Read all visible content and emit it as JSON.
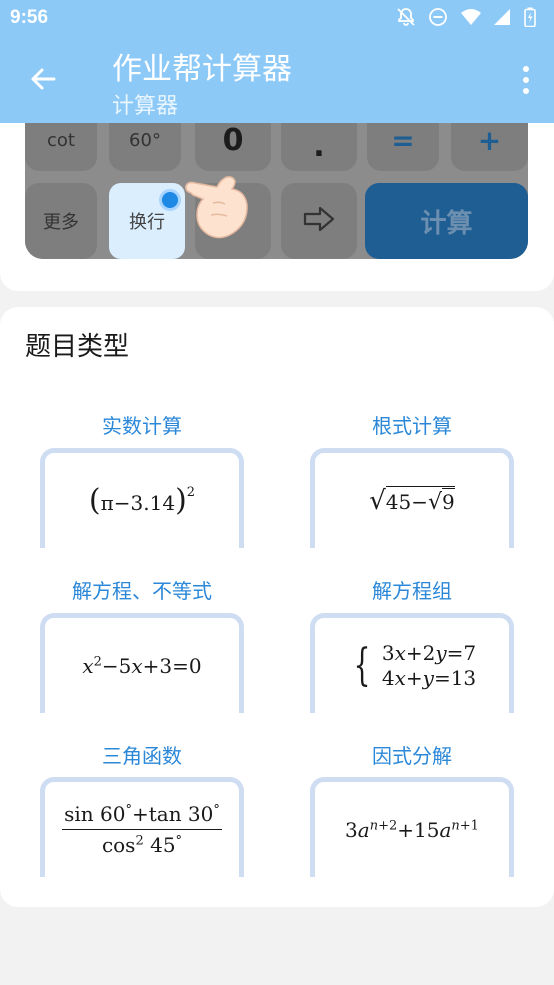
{
  "status_bar": {
    "time": "9:56"
  },
  "header": {
    "title": "作业帮计算器",
    "subtitle": "计算器"
  },
  "calculator_preview": {
    "row1": [
      "cot",
      "60°",
      "0",
      ".",
      "=",
      "+"
    ],
    "row2": {
      "more": "更多",
      "newline": "换行",
      "calc": "计算"
    }
  },
  "question_types": {
    "title": "题目类型",
    "categories": [
      {
        "label": "实数计算",
        "expr": "(π−3.14)²"
      },
      {
        "label": "根式计算",
        "expr": "√(45−√9)"
      },
      {
        "label": "解方程、不等式",
        "expr": "x²−5x+3=0"
      },
      {
        "label": "解方程组",
        "expr": "3x+2y=7; 4x+y=13"
      },
      {
        "label": "三角函数",
        "expr": "(sin 60°+tan 30°)/(cos² 45°)"
      },
      {
        "label": "因式分解",
        "expr": "3a^(n+2)+15a^(n+1)"
      }
    ]
  },
  "colors": {
    "appbar": "#8cc9f7",
    "label_blue": "#2b88d8",
    "box_border": "#cfddf3"
  }
}
